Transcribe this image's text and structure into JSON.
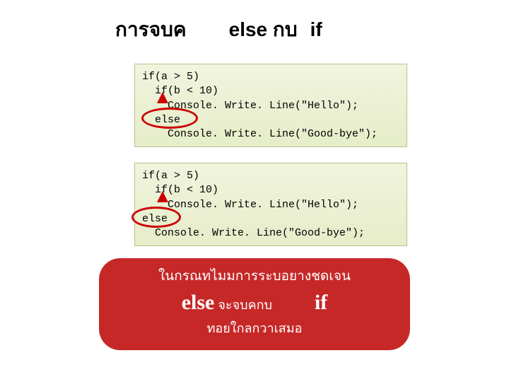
{
  "title": {
    "part1": "การจบค",
    "part2": "else กบ",
    "part3": "if"
  },
  "code1": {
    "l1": "if(a > 5)",
    "l2": "  if(b < 10)",
    "l3": "    Console. Write. Line(\"Hello\");",
    "l4": "  else",
    "l5": "    Console. Write. Line(\"Good-bye\");"
  },
  "code2": {
    "l1": "if(a > 5)",
    "l2": "  if(b < 10)",
    "l3": "    Console. Write. Line(\"Hello\");",
    "l4": "else",
    "l5": "  Console. Write. Line(\"Good-bye\");"
  },
  "caption": {
    "line1": "ในกรณทไมมการระบอยางชดเจน",
    "kw1": "else",
    "mid": " จะจบคกบ",
    "kw2": "if",
    "line3": "ทอยใกลกวาเสมอ"
  }
}
